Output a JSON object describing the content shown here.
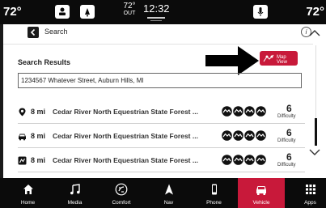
{
  "status_bar": {
    "left_temp": "72°",
    "right_temp": "72°",
    "outside_temp": "72°",
    "outside_label": "OUT",
    "time": "12:32"
  },
  "header": {
    "title": "Search",
    "info_glyph": "i"
  },
  "results": {
    "title": "Search Results",
    "map_view_label": "Map View",
    "address": "1234567 Whatever Street, Auburn Hills, MI",
    "items": [
      {
        "icon": "location-pin-icon",
        "distance": "8 mi",
        "name": "Cedar River North Equestrian State Forest ...",
        "difficulty": "6",
        "difficulty_label": "Difficulty"
      },
      {
        "icon": "vehicle-icon",
        "distance": "8 mi",
        "name": "Cedar River North Equestrian State Forest ...",
        "difficulty": "6",
        "difficulty_label": "Difficulty"
      },
      {
        "icon": "trail-icon",
        "distance": "8 mi",
        "name": "Cedar River North Equestrian State Forest ...",
        "difficulty": "6",
        "difficulty_label": "Difficulty"
      }
    ]
  },
  "nav": {
    "tabs": [
      {
        "label": "Home",
        "icon": "home-icon"
      },
      {
        "label": "Media",
        "icon": "music-note-icon"
      },
      {
        "label": "Comfort",
        "icon": "comfort-icon"
      },
      {
        "label": "Nav",
        "icon": "navigation-arrow-icon"
      },
      {
        "label": "Phone",
        "icon": "phone-icon"
      },
      {
        "label": "Vehicle",
        "icon": "vehicle-icon",
        "active": true
      },
      {
        "label": "Apps",
        "icon": "apps-grid-icon"
      }
    ]
  },
  "colors": {
    "accent": "#c8193a",
    "bar_background": "#0b0b0b",
    "screen_background": "#ffffff"
  }
}
